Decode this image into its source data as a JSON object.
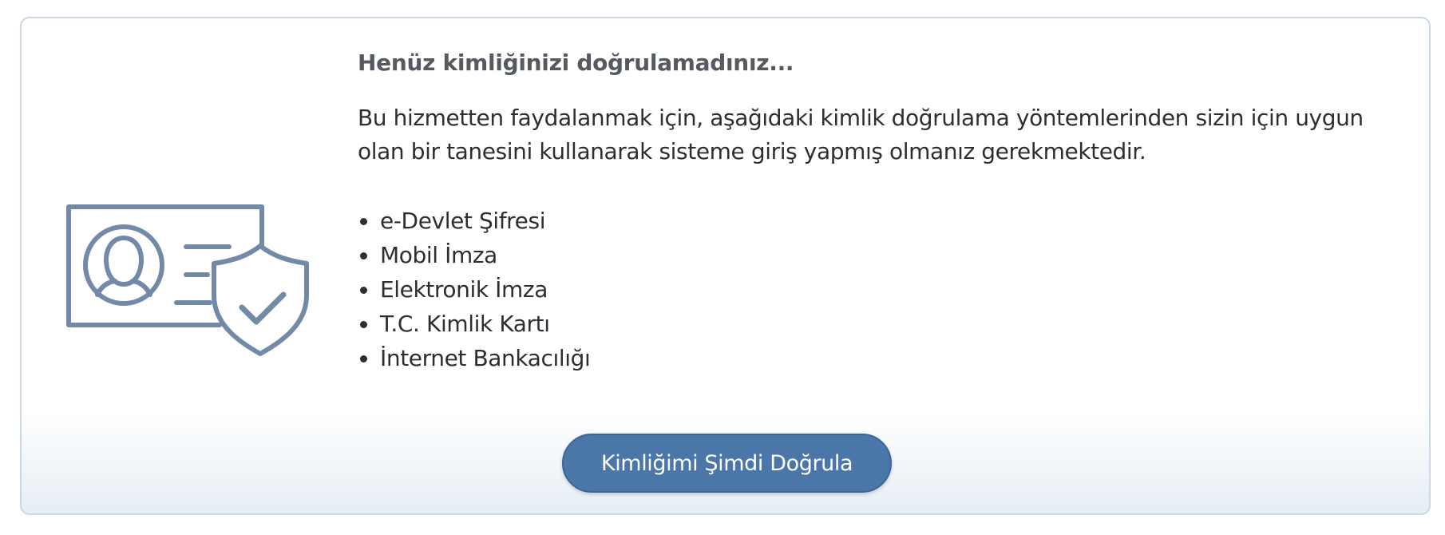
{
  "panel": {
    "heading": "Henüz kimliğinizi doğrulamadınız...",
    "description": "Bu hizmetten faydalanmak için, aşağıdaki kimlik doğrulama yöntemlerinden sizin için uygun olan bir tanesini kullanarak sisteme giriş yapmış olmanız gerekmektedir.",
    "methods": [
      "e-Devlet Şifresi",
      "Mobil İmza",
      "Elektronik İmza",
      "T.C. Kimlik Kartı",
      "İnternet Bankacılığı"
    ],
    "verify_button_label": "Kimliğimi Şimdi Doğrula",
    "illustration_icon": "identity-card-shield-icon"
  },
  "colors": {
    "icon": "#7289a8",
    "button": "#4a76a8",
    "border": "#c9d7e6"
  }
}
